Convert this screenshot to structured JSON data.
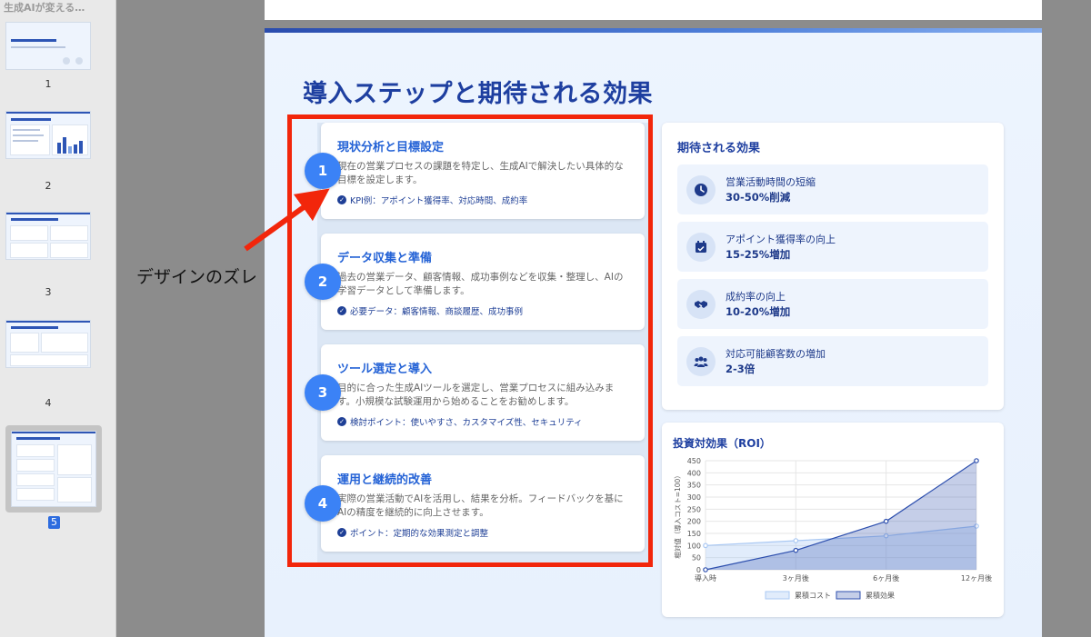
{
  "sidebar": {
    "title": "生成AIが変える…",
    "slides": [
      {
        "number": "1"
      },
      {
        "number": "2"
      },
      {
        "number": "3"
      },
      {
        "number": "4"
      },
      {
        "number": "5",
        "selected": true
      }
    ]
  },
  "slide": {
    "title": "導入ステップと期待される効果",
    "steps": [
      {
        "num": "1",
        "title": "現状分析と目標設定",
        "desc": "現在の営業プロセスの課題を特定し、生成AIで解決したい具体的な目標を設定します。",
        "note": "KPI例：アポイント獲得率、対応時間、成約率"
      },
      {
        "num": "2",
        "title": "データ収集と準備",
        "desc": "過去の営業データ、顧客情報、成功事例などを収集・整理し、AIの学習データとして準備します。",
        "note": "必要データ：顧客情報、商談履歴、成功事例"
      },
      {
        "num": "3",
        "title": "ツール選定と導入",
        "desc": "目的に合った生成AIツールを選定し、営業プロセスに組み込みます。小規模な試験運用から始めることをお勧めします。",
        "note": "検討ポイント：使いやすさ、カスタマイズ性、セキュリティ"
      },
      {
        "num": "4",
        "title": "運用と継続的改善",
        "desc": "実際の営業活動でAIを活用し、結果を分析。フィードバックを基にAIの精度を継続的に向上させます。",
        "note": "ポイント：定期的な効果測定と調整"
      }
    ],
    "effects": {
      "title": "期待される効果",
      "items": [
        {
          "icon": "clock-icon",
          "label": "営業活動時間の短縮",
          "value": "30-50%削減"
        },
        {
          "icon": "calendar-check-icon",
          "label": "アポイント獲得率の向上",
          "value": "15-25%増加"
        },
        {
          "icon": "handshake-icon",
          "label": "成約率の向上",
          "value": "10-20%増加"
        },
        {
          "icon": "users-icon",
          "label": "対応可能顧客数の増加",
          "value": "2-3倍"
        }
      ]
    },
    "roi_title": "投資対効果（ROI）"
  },
  "annotation": {
    "label": "デザインのズレ",
    "color": "#f2260b"
  },
  "colors": {
    "accent": "#1e3fa0",
    "step_number": "#3b82f6",
    "cost_series": "#a9c8f3",
    "effect_series": "#2d4fae"
  },
  "chart_data": {
    "type": "area",
    "title": "",
    "categories": [
      "導入時",
      "3ヶ月後",
      "6ヶ月後",
      "12ヶ月後"
    ],
    "series": [
      {
        "name": "累積コスト",
        "values": [
          100,
          120,
          140,
          180
        ]
      },
      {
        "name": "累積効果",
        "values": [
          0,
          80,
          200,
          450
        ]
      }
    ],
    "ylabel": "相対値（導入コスト=100）",
    "xlabel": "",
    "ylim": [
      0,
      450
    ],
    "yticks": [
      0,
      50,
      100,
      150,
      200,
      250,
      300,
      350,
      400,
      450
    ],
    "grid": true,
    "legend": "bottom"
  }
}
